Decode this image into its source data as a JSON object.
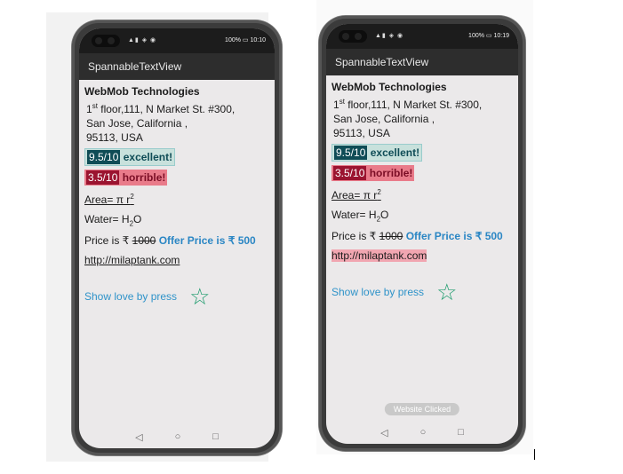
{
  "screens": [
    {
      "status_time": "10:10",
      "status_battery": "100%",
      "app_title": "SpannableTextView",
      "company": "WebMob Technologies",
      "addr_prefix": "1",
      "addr_sup": "st",
      "addr_line1": " floor,111, N Market St. #300,",
      "addr_line2": "San Jose, California ,",
      "addr_line3": "95113, USA",
      "good_score": "9.5/10",
      "good_word": "excellent!",
      "bad_score": "3.5/10",
      "bad_word": "horrible!",
      "area_text": "Area= π r",
      "area_sup": "2",
      "water_text": "Water= H",
      "water_sub": "2",
      "water_tail": "O",
      "price_label": "Price is ₹ ",
      "price_old": "1000",
      "price_offer": "Offer Price is ₹ 500",
      "url": "http://milaptank.com",
      "love_text": "Show love by press",
      "toast": ""
    },
    {
      "status_time": "10:19",
      "status_battery": "100%",
      "app_title": "SpannableTextView",
      "company": "WebMob Technologies",
      "addr_prefix": "1",
      "addr_sup": "st",
      "addr_line1": " floor,111, N Market St. #300,",
      "addr_line2": "San Jose, California ,",
      "addr_line3": "95113, USA",
      "good_score": "9.5/10",
      "good_word": "excellent!",
      "bad_score": "3.5/10",
      "bad_word": "horrible!",
      "area_text": "Area= π r",
      "area_sup": "2",
      "water_text": "Water= H",
      "water_sub": "2",
      "water_tail": "O",
      "price_label": "Price is ₹ ",
      "price_old": "1000",
      "price_offer": "Offer Price is ₹ 500",
      "url": "http://milaptank.com",
      "love_text": "Show love by press",
      "toast": "Website Clicked"
    }
  ],
  "colors": {
    "offer": "#2a86c4",
    "good_badge": "#0f4c56",
    "bad_badge": "#9b1430",
    "star": "#1f9c6e"
  },
  "icons": [
    "star-outline-icon",
    "back-triangle-icon",
    "home-circle-icon",
    "recents-square-icon"
  ]
}
